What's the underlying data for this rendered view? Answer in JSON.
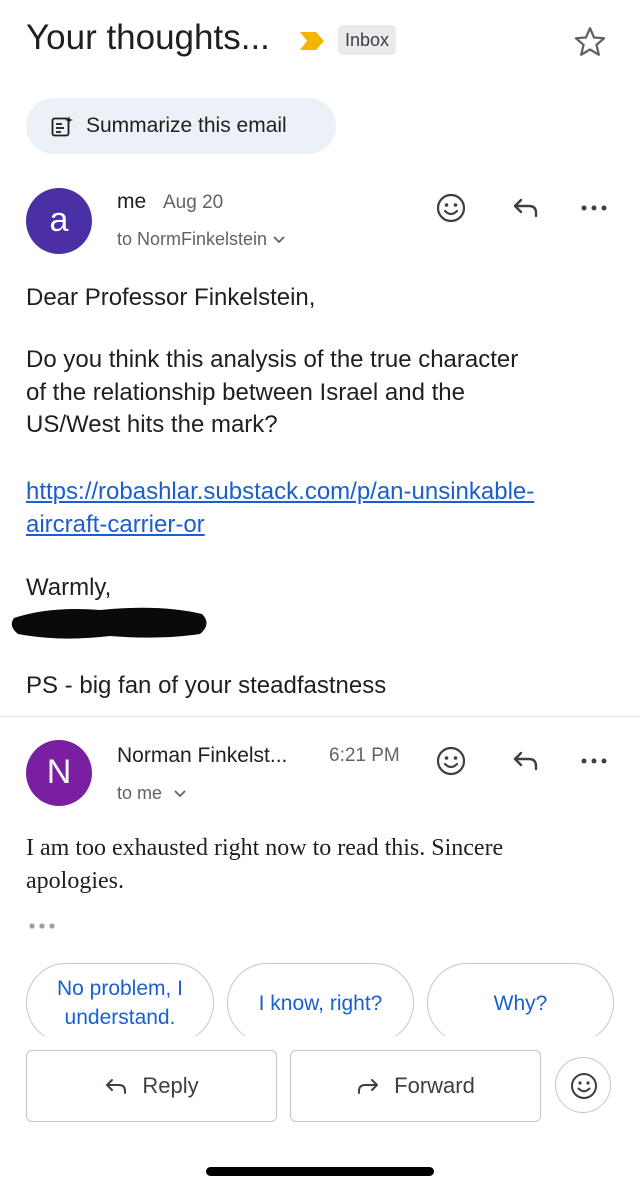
{
  "header": {
    "subject": "Your thoughts...",
    "label_chip": "Inbox",
    "importance_icon": "importance-marker-icon",
    "star_icon": "star-outline-icon"
  },
  "summarize": {
    "label": "Summarize this email",
    "icon": "summarize-sparkle-icon"
  },
  "messages": [
    {
      "avatar_letter": "a",
      "avatar_color": "#4a2fa5",
      "sender": "me",
      "date": "Aug 20",
      "recipient": "to NormFinkelstein",
      "body": {
        "greeting": "Dear Professor Finkelstein,",
        "paragraph_lines": [
          "Do you think this analysis of the true character",
          "of the relationship between Israel and the",
          "US/West hits the mark?"
        ],
        "link_lines": [
          "https://robashlar.substack.com/p/an-unsinkable-",
          "aircraft-carrier-or"
        ],
        "signoff": "Warmly,",
        "ps": "PS - big fan of your steadfastness"
      }
    },
    {
      "avatar_letter": "N",
      "avatar_color": "#7b1fa2",
      "sender": "Norman Finkelst...",
      "date": "6:21 PM",
      "recipient": "to me",
      "body": {
        "lines": [
          "I am too exhausted right now to read this.  Sincere",
          "apologies."
        ]
      }
    }
  ],
  "smart_replies": [
    "No problem, I\nunderstand.",
    "I know, right?",
    "Why?"
  ],
  "actions": {
    "reply": "Reply",
    "forward": "Forward"
  },
  "colors": {
    "link": "#1a5fd0",
    "importance": "#f4b400",
    "chip_bg": "#ecf1f7"
  }
}
